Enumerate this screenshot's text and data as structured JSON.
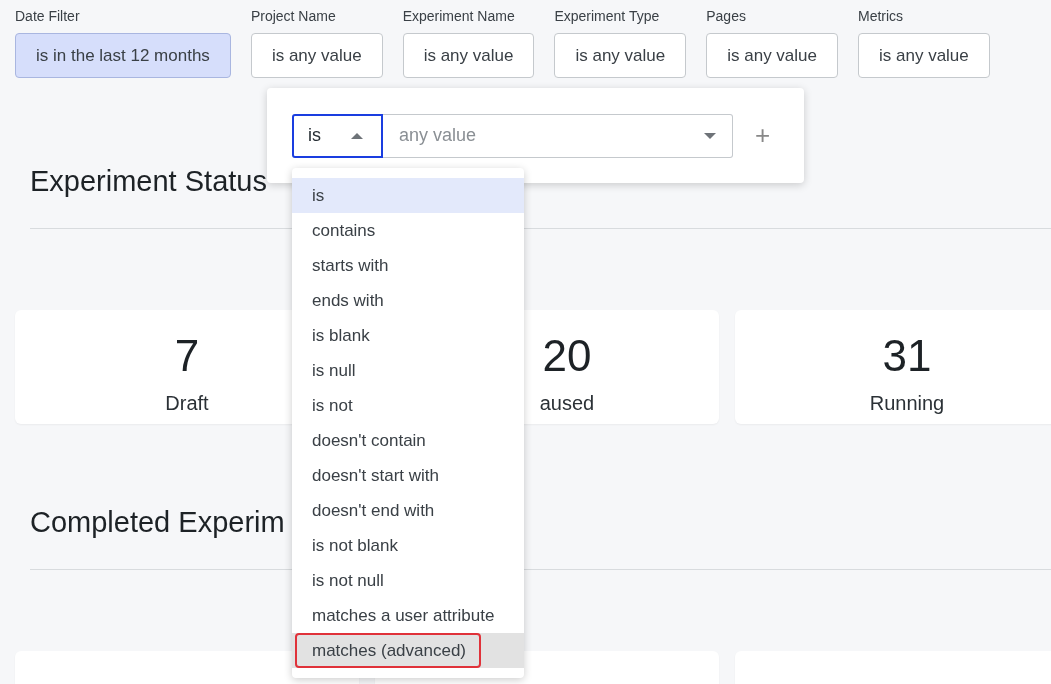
{
  "filters": [
    {
      "label": "Date Filter",
      "value": "is in the last 12 months",
      "highlighted": true
    },
    {
      "label": "Project Name",
      "value": "is any value",
      "highlighted": false
    },
    {
      "label": "Experiment Name",
      "value": "is any value",
      "highlighted": false
    },
    {
      "label": "Experiment Type",
      "value": "is any value",
      "highlighted": false
    },
    {
      "label": "Pages",
      "value": "is any value",
      "highlighted": false
    },
    {
      "label": "Metrics",
      "value": "is any value",
      "highlighted": false
    }
  ],
  "popover": {
    "operator": "is",
    "operator_open": true,
    "value_placeholder": "any value",
    "add": "+"
  },
  "menu": {
    "items": [
      {
        "label": "is",
        "selected": true,
        "hovered": false,
        "annotated": false
      },
      {
        "label": "contains",
        "selected": false,
        "hovered": false,
        "annotated": false
      },
      {
        "label": "starts with",
        "selected": false,
        "hovered": false,
        "annotated": false
      },
      {
        "label": "ends with",
        "selected": false,
        "hovered": false,
        "annotated": false
      },
      {
        "label": "is blank",
        "selected": false,
        "hovered": false,
        "annotated": false
      },
      {
        "label": "is null",
        "selected": false,
        "hovered": false,
        "annotated": false
      },
      {
        "label": "is not",
        "selected": false,
        "hovered": false,
        "annotated": false
      },
      {
        "label": "doesn't contain",
        "selected": false,
        "hovered": false,
        "annotated": false
      },
      {
        "label": "doesn't start with",
        "selected": false,
        "hovered": false,
        "annotated": false
      },
      {
        "label": "doesn't end with",
        "selected": false,
        "hovered": false,
        "annotated": false
      },
      {
        "label": "is not blank",
        "selected": false,
        "hovered": false,
        "annotated": false
      },
      {
        "label": "is not null",
        "selected": false,
        "hovered": false,
        "annotated": false
      },
      {
        "label": "matches a user attribute",
        "selected": false,
        "hovered": false,
        "annotated": false
      },
      {
        "label": "matches (advanced)",
        "selected": false,
        "hovered": true,
        "annotated": true
      }
    ]
  },
  "sections": [
    {
      "title": "Experiment Status",
      "cards": [
        {
          "value": "7",
          "label": "Draft"
        },
        {
          "value": "20",
          "label": "aused"
        },
        {
          "value": "31",
          "label": "Running"
        }
      ]
    },
    {
      "title": "Completed Experim",
      "cards": [
        {
          "kind": "stat"
        },
        {
          "kind": "stat"
        },
        {
          "kind": "stat"
        }
      ]
    }
  ]
}
